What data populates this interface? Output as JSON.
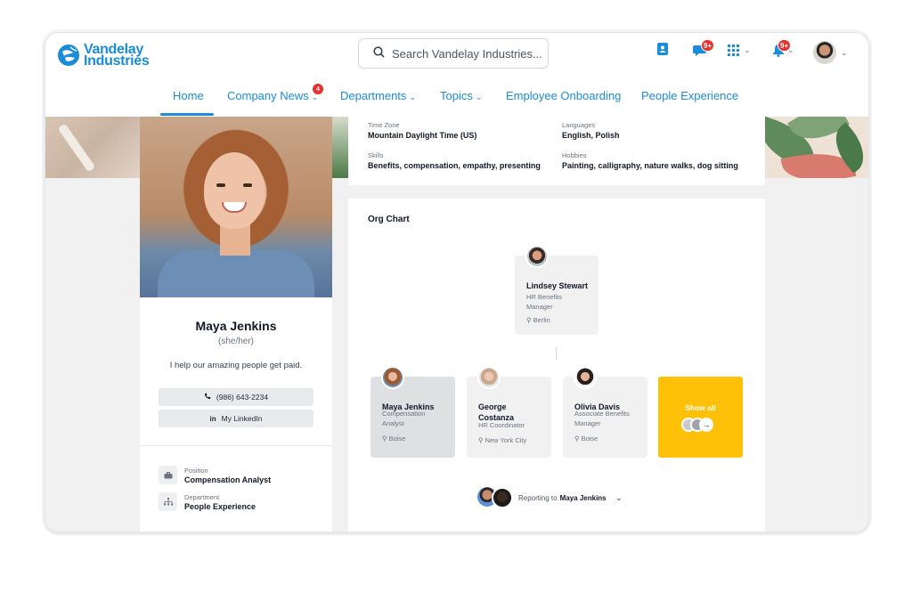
{
  "brand": {
    "line1": "Vandelay",
    "line2": "Industries",
    "color": "#1a8cd8"
  },
  "search": {
    "placeholder": "Search Vandelay Industries..."
  },
  "header_icons": {
    "contacts": "contacts-book-icon",
    "chat": "chat-bubble-icon",
    "chat_badge": "9+",
    "apps": "app-grid-icon",
    "notifications": "bell-icon",
    "notifications_badge": "9+",
    "avatar": "user-avatar"
  },
  "nav": {
    "items": [
      {
        "label": "Home",
        "active": true
      },
      {
        "label": "Company News",
        "dropdown": true,
        "badge": "4"
      },
      {
        "label": "Departments",
        "dropdown": true
      },
      {
        "label": "Topics",
        "dropdown": true
      },
      {
        "label": "Employee Onboarding"
      },
      {
        "label": "People Experience"
      }
    ]
  },
  "profile": {
    "name": "Maya Jenkins",
    "pronouns": "(she/her)",
    "bio": "I help our amazing people get paid.",
    "phone": "(986) 643-2234",
    "linkedin": "My LinkedIn",
    "fields": [
      {
        "label": "Position",
        "value": "Compensation Analyst",
        "icon": "briefcase-icon"
      },
      {
        "label": "Department",
        "value": "People Experience",
        "icon": "org-tree-icon"
      }
    ]
  },
  "details": {
    "time_zone_label": "Time Zone",
    "time_zone": "Mountain Daylight Time (US)",
    "languages_label": "Languages",
    "languages": "English, Polish",
    "skills_label": "Skills",
    "skills": "Benefits, compensation, empathy, presenting",
    "hobbies_label": "Hobbies",
    "hobbies": "Painting, calligraphy, nature walks, dog sitting"
  },
  "org_chart": {
    "title": "Org Chart",
    "manager": {
      "name": "Lindsey Stewart",
      "role_line1": "HR Benefits",
      "role_line2": "Manager",
      "location": "Berlin"
    },
    "peers": [
      {
        "name_line1": "Maya Jenkins",
        "name_line2": "",
        "role_line1": "Compensation",
        "role_line2": "Analyst",
        "location": "Boise"
      },
      {
        "name_line1": "George",
        "name_line2": "Costanza",
        "role_line1": "HR Coordinator",
        "role_line2": "",
        "location": "New York City"
      },
      {
        "name_line1": "Olivia Davis",
        "name_line2": "",
        "role_line1": "Associate Benefits",
        "role_line2": "Manager",
        "location": "Boise"
      }
    ],
    "show_all": "Show all",
    "reporting_prefix": "Reporting to",
    "reporting_name": "Maya Jenkins"
  }
}
